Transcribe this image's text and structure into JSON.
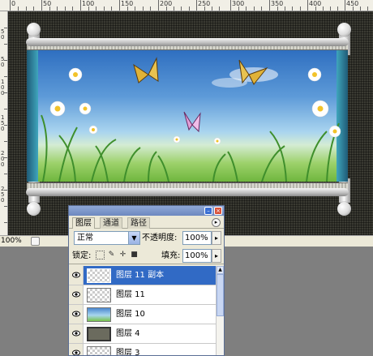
{
  "ruler": {
    "top_labels": [
      "0",
      "50",
      "100",
      "150",
      "200",
      "250",
      "300",
      "350",
      "400",
      "450"
    ],
    "left_labels": [
      "5",
      "0",
      "5",
      "0",
      "1",
      "0",
      "0",
      "1",
      "5",
      "0",
      "2",
      "0",
      "0",
      "2",
      "5",
      "0"
    ]
  },
  "status": {
    "zoom": "100%"
  },
  "layers_panel": {
    "tabs": [
      "图层",
      "通道",
      "路径"
    ],
    "active_tab": "图层",
    "blend_mode": "正常",
    "opacity_label": "不透明度:",
    "opacity_value": "100%",
    "lock_label": "锁定:",
    "fill_label": "填充:",
    "fill_value": "100%",
    "layers": [
      {
        "name": "图层 11 副本",
        "thumb": "transparent",
        "selected": true
      },
      {
        "name": "图层 11",
        "thumb": "transparent",
        "selected": false
      },
      {
        "name": "图层 10",
        "thumb": "image",
        "selected": false
      },
      {
        "name": "图层 4",
        "thumb": "frame",
        "selected": false
      },
      {
        "name": "图层 3",
        "thumb": "transparent",
        "selected": false
      }
    ],
    "icons": {
      "minimize": "minimize-icon",
      "close": "close-icon",
      "menu": "panel-menu-icon",
      "visibility": "eye-icon",
      "lock_transparent": "lock-transparency-icon",
      "lock_paint": "brush-icon",
      "lock_move": "move-icon",
      "lock_all": "lock-icon"
    }
  }
}
